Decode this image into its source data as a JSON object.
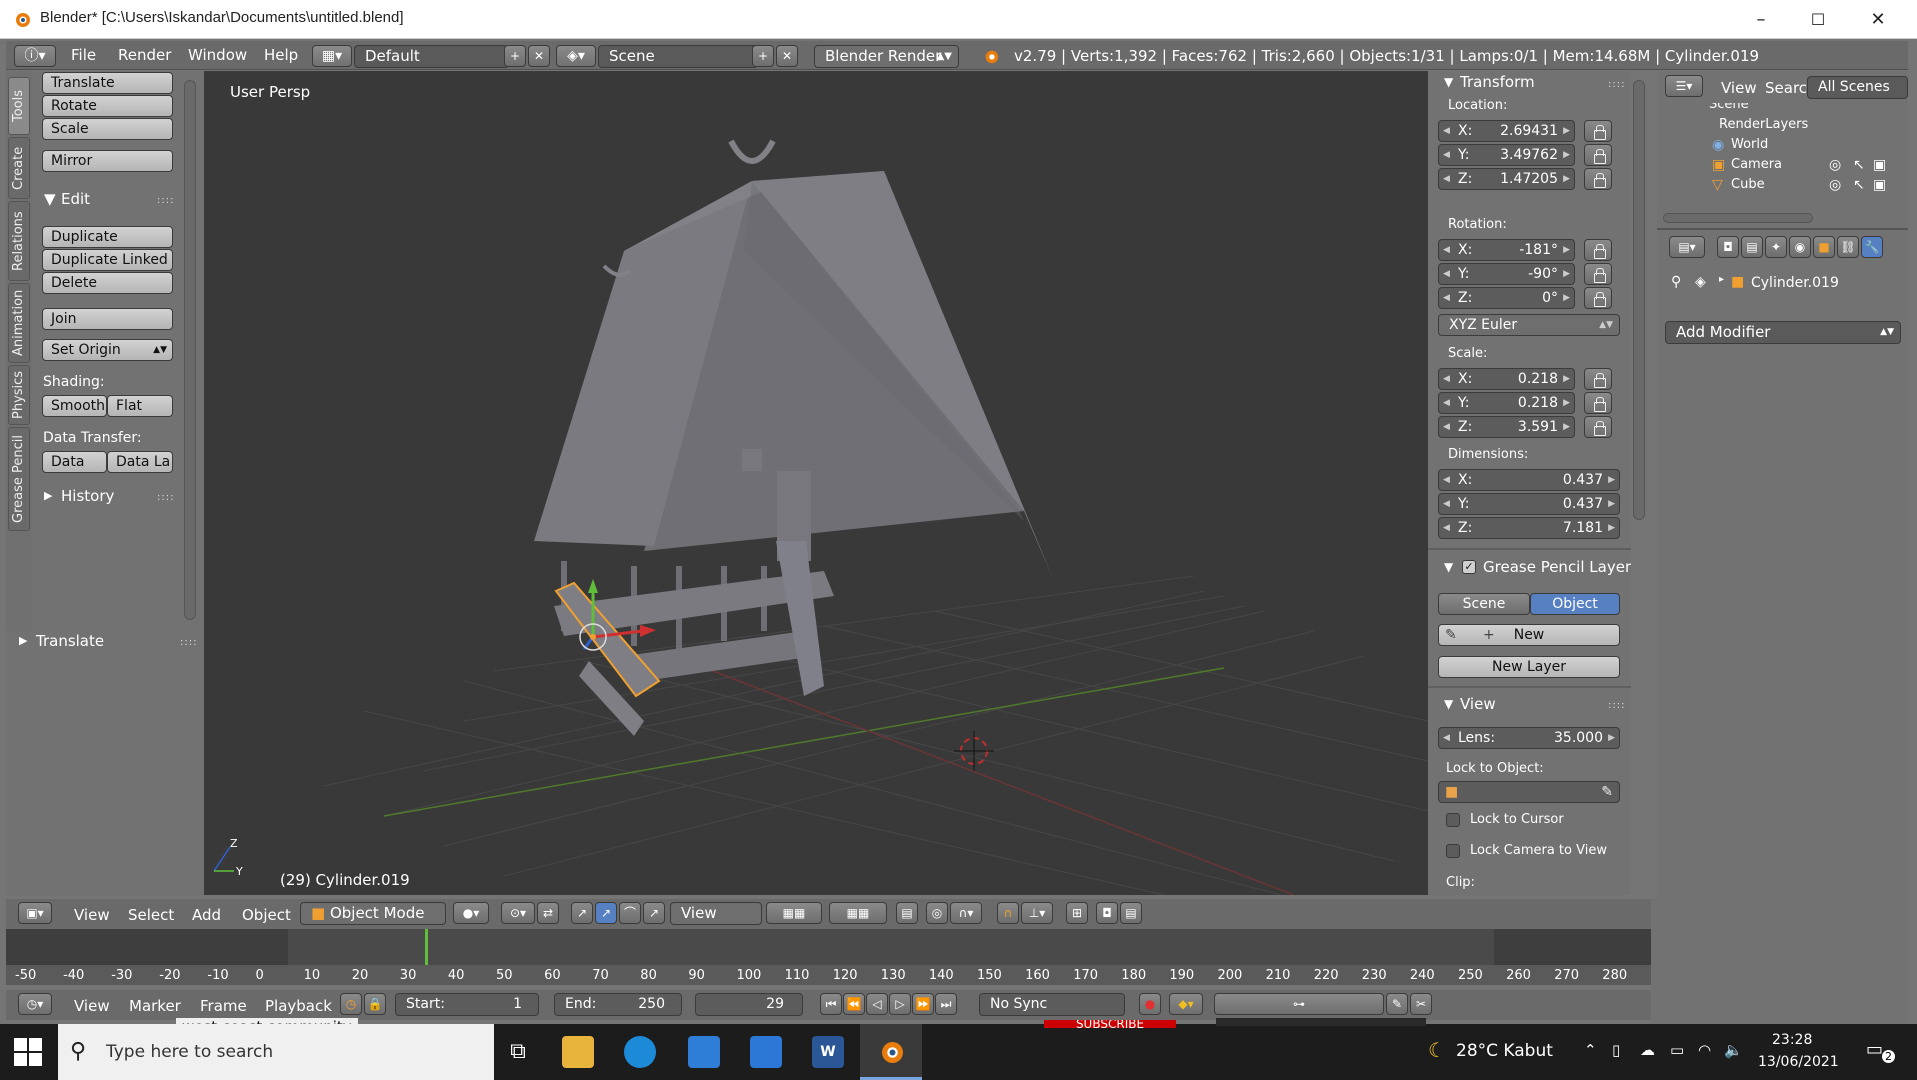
{
  "window": {
    "title": "Blender* [C:\\Users\\Iskandar\\Documents\\untitled.blend]",
    "minimize": "–",
    "maximize": "☐",
    "close": "✕"
  },
  "info_header": {
    "menus": [
      "File",
      "Render",
      "Window",
      "Help"
    ],
    "layout": "Default",
    "scene": "Scene",
    "engine": "Blender Render",
    "stats": "v2.79 | Verts:1,392 | Faces:762 | Tris:2,660 | Objects:1/31 | Lamps:0/1 | Mem:14.68M | Cylinder.019"
  },
  "tool_tabs": [
    "Tools",
    "Create",
    "Relations",
    "Animation",
    "Physics",
    "Grease Pencil"
  ],
  "tool_shelf": {
    "transform_buttons": [
      "Translate",
      "Rotate",
      "Scale"
    ],
    "mirror": "Mirror",
    "edit_header": "Edit",
    "edit_buttons": [
      "Duplicate",
      "Duplicate Linked",
      "Delete"
    ],
    "join": "Join",
    "set_origin": "Set Origin",
    "shading_label": "Shading:",
    "smooth": "Smooth",
    "flat": "Flat",
    "data_transfer_label": "Data Transfer:",
    "data": "Data",
    "data_layers": "Data La",
    "history": "History",
    "operator_panel": "Translate"
  },
  "viewport": {
    "view_label": "User Persp",
    "object_label": "(29) Cylinder.019",
    "axis_z": "Z",
    "axis_y": "Y"
  },
  "n_panel": {
    "transform": {
      "header": "Transform",
      "location_label": "Location:",
      "location": [
        {
          "axis": "X:",
          "value": "2.69431"
        },
        {
          "axis": "Y:",
          "value": "3.49762"
        },
        {
          "axis": "Z:",
          "value": "1.47205"
        }
      ],
      "rotation_label": "Rotation:",
      "rotation": [
        {
          "axis": "X:",
          "value": "-181°"
        },
        {
          "axis": "Y:",
          "value": "-90°"
        },
        {
          "axis": "Z:",
          "value": "0°"
        }
      ],
      "rotation_mode": "XYZ Euler",
      "scale_label": "Scale:",
      "scale": [
        {
          "axis": "X:",
          "value": "0.218"
        },
        {
          "axis": "Y:",
          "value": "0.218"
        },
        {
          "axis": "Z:",
          "value": "3.591"
        }
      ],
      "dimensions_label": "Dimensions:",
      "dimensions": [
        {
          "axis": "X:",
          "value": "0.437"
        },
        {
          "axis": "Y:",
          "value": "0.437"
        },
        {
          "axis": "Z:",
          "value": "7.181"
        }
      ]
    },
    "grease_pencil": {
      "header": "Grease Pencil Layer",
      "scene": "Scene",
      "object": "Object",
      "new": "New",
      "new_layer": "New Layer"
    },
    "view": {
      "header": "View",
      "lens_label": "Lens:",
      "lens_value": "35.000",
      "lock_object_label": "Lock to Object:",
      "lock_cursor": "Lock to Cursor",
      "lock_camera": "Lock Camera to View",
      "clip_label": "Clip:"
    }
  },
  "outliner": {
    "view": "View",
    "search": "Search",
    "scene_select": "All Scenes",
    "items": [
      "Scene",
      "RenderLayers",
      "World",
      "Camera",
      "Cube"
    ]
  },
  "properties": {
    "object_name": "Cylinder.019",
    "add_modifier": "Add Modifier"
  },
  "viewport_header": {
    "menus": [
      "View",
      "Select",
      "Add",
      "Object"
    ],
    "mode": "Object Mode",
    "pivot_view": "View"
  },
  "timeline": {
    "ticks": [
      "-50",
      "-40",
      "-30",
      "-20",
      "-10",
      "0",
      "10",
      "20",
      "30",
      "40",
      "50",
      "60",
      "70",
      "80",
      "90",
      "100",
      "110",
      "120",
      "130",
      "140",
      "150",
      "160",
      "170",
      "180",
      "190",
      "200",
      "210",
      "220",
      "230",
      "240",
      "250",
      "260",
      "270",
      "280"
    ],
    "current_frame_marker": 29,
    "menus": [
      "View",
      "Marker",
      "Frame",
      "Playback"
    ],
    "start_label": "Start:",
    "start": "1",
    "end_label": "End:",
    "end": "250",
    "current": "29",
    "sync": "No Sync"
  },
  "taskbar": {
    "search_placeholder": "Type here to search",
    "weather": "28°C  Kabut",
    "time": "23:28",
    "date": "13/06/2021",
    "notification_count": "2",
    "behind_text_1": "west coast community",
    "behind_text_2": "SUBSCRIBE"
  },
  "colors": {
    "selected_button": "#5680c2",
    "object_outline": "#f0a030",
    "x_axis": "#c23b3b",
    "y_axis": "#6a9a2a",
    "blender_orange": "#e87d0d"
  }
}
